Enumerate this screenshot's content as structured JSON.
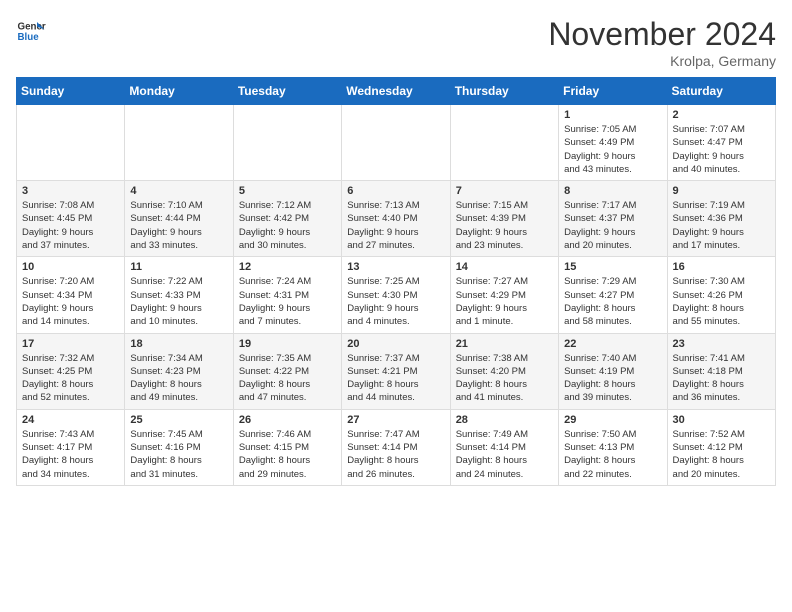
{
  "header": {
    "logo_line1": "General",
    "logo_line2": "Blue",
    "month": "November 2024",
    "location": "Krolpa, Germany"
  },
  "weekdays": [
    "Sunday",
    "Monday",
    "Tuesday",
    "Wednesday",
    "Thursday",
    "Friday",
    "Saturday"
  ],
  "weeks": [
    [
      {
        "day": "",
        "info": ""
      },
      {
        "day": "",
        "info": ""
      },
      {
        "day": "",
        "info": ""
      },
      {
        "day": "",
        "info": ""
      },
      {
        "day": "",
        "info": ""
      },
      {
        "day": "1",
        "info": "Sunrise: 7:05 AM\nSunset: 4:49 PM\nDaylight: 9 hours\nand 43 minutes."
      },
      {
        "day": "2",
        "info": "Sunrise: 7:07 AM\nSunset: 4:47 PM\nDaylight: 9 hours\nand 40 minutes."
      }
    ],
    [
      {
        "day": "3",
        "info": "Sunrise: 7:08 AM\nSunset: 4:45 PM\nDaylight: 9 hours\nand 37 minutes."
      },
      {
        "day": "4",
        "info": "Sunrise: 7:10 AM\nSunset: 4:44 PM\nDaylight: 9 hours\nand 33 minutes."
      },
      {
        "day": "5",
        "info": "Sunrise: 7:12 AM\nSunset: 4:42 PM\nDaylight: 9 hours\nand 30 minutes."
      },
      {
        "day": "6",
        "info": "Sunrise: 7:13 AM\nSunset: 4:40 PM\nDaylight: 9 hours\nand 27 minutes."
      },
      {
        "day": "7",
        "info": "Sunrise: 7:15 AM\nSunset: 4:39 PM\nDaylight: 9 hours\nand 23 minutes."
      },
      {
        "day": "8",
        "info": "Sunrise: 7:17 AM\nSunset: 4:37 PM\nDaylight: 9 hours\nand 20 minutes."
      },
      {
        "day": "9",
        "info": "Sunrise: 7:19 AM\nSunset: 4:36 PM\nDaylight: 9 hours\nand 17 minutes."
      }
    ],
    [
      {
        "day": "10",
        "info": "Sunrise: 7:20 AM\nSunset: 4:34 PM\nDaylight: 9 hours\nand 14 minutes."
      },
      {
        "day": "11",
        "info": "Sunrise: 7:22 AM\nSunset: 4:33 PM\nDaylight: 9 hours\nand 10 minutes."
      },
      {
        "day": "12",
        "info": "Sunrise: 7:24 AM\nSunset: 4:31 PM\nDaylight: 9 hours\nand 7 minutes."
      },
      {
        "day": "13",
        "info": "Sunrise: 7:25 AM\nSunset: 4:30 PM\nDaylight: 9 hours\nand 4 minutes."
      },
      {
        "day": "14",
        "info": "Sunrise: 7:27 AM\nSunset: 4:29 PM\nDaylight: 9 hours\nand 1 minute."
      },
      {
        "day": "15",
        "info": "Sunrise: 7:29 AM\nSunset: 4:27 PM\nDaylight: 8 hours\nand 58 minutes."
      },
      {
        "day": "16",
        "info": "Sunrise: 7:30 AM\nSunset: 4:26 PM\nDaylight: 8 hours\nand 55 minutes."
      }
    ],
    [
      {
        "day": "17",
        "info": "Sunrise: 7:32 AM\nSunset: 4:25 PM\nDaylight: 8 hours\nand 52 minutes."
      },
      {
        "day": "18",
        "info": "Sunrise: 7:34 AM\nSunset: 4:23 PM\nDaylight: 8 hours\nand 49 minutes."
      },
      {
        "day": "19",
        "info": "Sunrise: 7:35 AM\nSunset: 4:22 PM\nDaylight: 8 hours\nand 47 minutes."
      },
      {
        "day": "20",
        "info": "Sunrise: 7:37 AM\nSunset: 4:21 PM\nDaylight: 8 hours\nand 44 minutes."
      },
      {
        "day": "21",
        "info": "Sunrise: 7:38 AM\nSunset: 4:20 PM\nDaylight: 8 hours\nand 41 minutes."
      },
      {
        "day": "22",
        "info": "Sunrise: 7:40 AM\nSunset: 4:19 PM\nDaylight: 8 hours\nand 39 minutes."
      },
      {
        "day": "23",
        "info": "Sunrise: 7:41 AM\nSunset: 4:18 PM\nDaylight: 8 hours\nand 36 minutes."
      }
    ],
    [
      {
        "day": "24",
        "info": "Sunrise: 7:43 AM\nSunset: 4:17 PM\nDaylight: 8 hours\nand 34 minutes."
      },
      {
        "day": "25",
        "info": "Sunrise: 7:45 AM\nSunset: 4:16 PM\nDaylight: 8 hours\nand 31 minutes."
      },
      {
        "day": "26",
        "info": "Sunrise: 7:46 AM\nSunset: 4:15 PM\nDaylight: 8 hours\nand 29 minutes."
      },
      {
        "day": "27",
        "info": "Sunrise: 7:47 AM\nSunset: 4:14 PM\nDaylight: 8 hours\nand 26 minutes."
      },
      {
        "day": "28",
        "info": "Sunrise: 7:49 AM\nSunset: 4:14 PM\nDaylight: 8 hours\nand 24 minutes."
      },
      {
        "day": "29",
        "info": "Sunrise: 7:50 AM\nSunset: 4:13 PM\nDaylight: 8 hours\nand 22 minutes."
      },
      {
        "day": "30",
        "info": "Sunrise: 7:52 AM\nSunset: 4:12 PM\nDaylight: 8 hours\nand 20 minutes."
      }
    ]
  ]
}
